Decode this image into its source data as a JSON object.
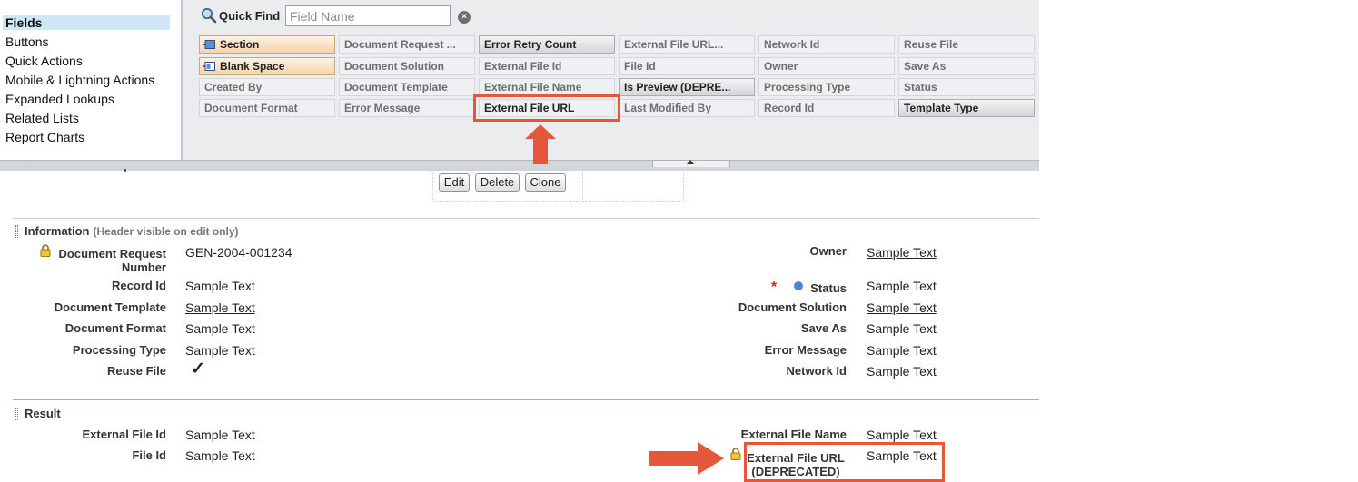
{
  "palette": {
    "categories": [
      {
        "label": "Fields",
        "selected": true
      },
      {
        "label": "Buttons"
      },
      {
        "label": "Quick Actions"
      },
      {
        "label": "Mobile & Lightning Actions"
      },
      {
        "label": "Expanded Lookups"
      },
      {
        "label": "Related Lists"
      },
      {
        "label": "Report Charts"
      }
    ],
    "quick_find": {
      "label": "Quick Find",
      "placeholder": "Field Name",
      "clear_glyph": "×"
    },
    "fields": [
      [
        "Section",
        "Document Request ...",
        "Error Retry Count",
        "External File URL...",
        "Network Id",
        "Reuse File"
      ],
      [
        "Blank Space",
        "Document Solution",
        "External File Id",
        "File Id",
        "Owner",
        "Save As"
      ],
      [
        "Created By",
        "Document Template",
        "External File Name",
        "Is Preview (DEPRE...",
        "Processing Type",
        "Status"
      ],
      [
        "Document Format",
        "Error Message",
        "External File URL",
        "Last Modified By",
        "Record Id",
        "Template Type"
      ]
    ]
  },
  "buttons": {
    "edit": "Edit",
    "delete": "Delete",
    "clone": "Clone"
  },
  "information": {
    "title": "Information",
    "note": "(Header visible on edit only)",
    "left": [
      {
        "label": "Document Request Number",
        "value": "GEN-2004-001234"
      },
      {
        "label": "Record Id",
        "value": "Sample Text"
      },
      {
        "label": "Document Template",
        "value": "Sample Text"
      },
      {
        "label": "Document Format",
        "value": "Sample Text"
      },
      {
        "label": "Processing Type",
        "value": "Sample Text"
      },
      {
        "label": "Reuse File",
        "value": "✓"
      }
    ],
    "right": [
      {
        "label": "Owner",
        "value": "Sample Text"
      },
      {
        "label": "Status",
        "value": "Sample Text"
      },
      {
        "label": "Document Solution",
        "value": "Sample Text"
      },
      {
        "label": "Save As",
        "value": "Sample Text"
      },
      {
        "label": "Error Message",
        "value": "Sample Text"
      },
      {
        "label": "Network Id",
        "value": "Sample Text"
      }
    ],
    "required_glyph": "*"
  },
  "result": {
    "title": "Result",
    "left": [
      {
        "label": "External File Id",
        "value": "Sample Text"
      },
      {
        "label": "File Id",
        "value": "Sample Text"
      }
    ],
    "right": [
      {
        "label": "External File Name",
        "value": "Sample Text"
      },
      {
        "label": "External File URL (DEPRECATED)",
        "label_line1": "External File URL",
        "label_line2": "(DEPRECATED)",
        "value": "Sample Text"
      }
    ]
  },
  "colors": {
    "highlight": "#e5573a",
    "accent_selected": "#cfe7f9",
    "section_line_info": "#c8cbce",
    "section_line_result": "#84b5d3"
  },
  "icons": {
    "quick_find": "search-icon",
    "clear": "clear-icon",
    "lock": "lock-icon",
    "status_dot": "status-dot-icon",
    "arrow": "arrow-icon"
  }
}
